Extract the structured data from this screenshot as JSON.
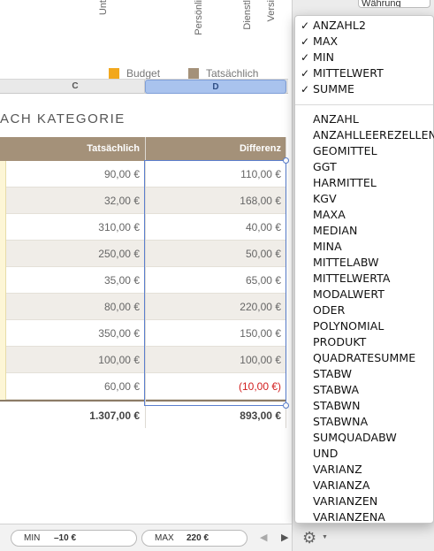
{
  "chart": {
    "vertical_labels": [
      "Unt",
      "Persönli",
      "Dienstl",
      "Versi"
    ],
    "legend": [
      {
        "label": "Budget",
        "color": "#f2a81d"
      },
      {
        "label": "Tatsächlich",
        "color": "#a49179"
      }
    ]
  },
  "column_headers": [
    "C",
    "D"
  ],
  "sheet_title": "ACH KATEGORIE",
  "table": {
    "headers": [
      "Tatsächlich",
      "Differenz"
    ],
    "rows": [
      {
        "tatsaechlich": "90,00 €",
        "differenz": "110,00 €",
        "negative": false
      },
      {
        "tatsaechlich": "32,00 €",
        "differenz": "168,00 €",
        "negative": false
      },
      {
        "tatsaechlich": "310,00 €",
        "differenz": "40,00 €",
        "negative": false
      },
      {
        "tatsaechlich": "250,00 €",
        "differenz": "50,00 €",
        "negative": false
      },
      {
        "tatsaechlich": "35,00 €",
        "differenz": "65,00 €",
        "negative": false
      },
      {
        "tatsaechlich": "80,00 €",
        "differenz": "220,00 €",
        "negative": false
      },
      {
        "tatsaechlich": "350,00 €",
        "differenz": "150,00 €",
        "negative": false
      },
      {
        "tatsaechlich": "100,00 €",
        "differenz": "100,00 €",
        "negative": false
      },
      {
        "tatsaechlich": "60,00 €",
        "differenz": "(10,00 €)",
        "negative": true
      }
    ],
    "totals": {
      "tatsaechlich": "1.307,00 €",
      "differenz": "893,00 €"
    }
  },
  "menu": {
    "checked_items": [
      "ANZAHL2",
      "MAX",
      "MIN",
      "MITTELWERT",
      "SUMME"
    ],
    "items": [
      "ANZAHL",
      "ANZAHLLEEREZELLEN",
      "GEOMITTEL",
      "GGT",
      "HARMITTEL",
      "KGV",
      "MAXA",
      "MEDIAN",
      "MINA",
      "MITTELABW",
      "MITTELWERTA",
      "MODALWERT",
      "ODER",
      "POLYNOMIAL",
      "PRODUKT",
      "QUADRATESUMME",
      "STABW",
      "STABWA",
      "STABWN",
      "STABWNA",
      "SUMQUADABW",
      "UND",
      "VARIANZ",
      "VARIANZA",
      "VARIANZEN",
      "VARIANZENA"
    ]
  },
  "side_panel": {
    "currency_field": "Währung"
  },
  "statusbar": {
    "min_label": "MIN",
    "min_value": "–10 €",
    "max_label": "MAX",
    "max_value": "220 €",
    "icons": [
      "nav-left-icon",
      "nav-right-icon",
      "gear-icon"
    ]
  },
  "colors": {
    "header_bg": "#a49179",
    "selection": "#5b7fce",
    "negative": "#d21f1f"
  }
}
